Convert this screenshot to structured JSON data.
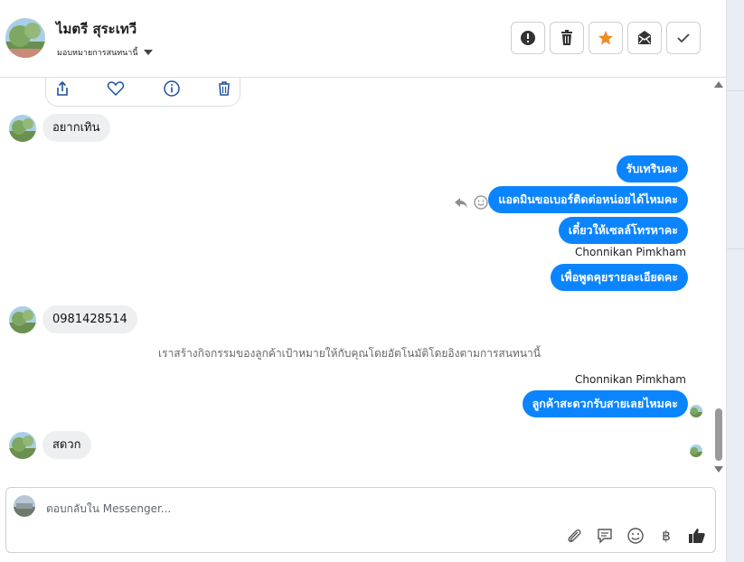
{
  "header": {
    "contact_name": "ไมตรี สุระเทวี",
    "assign_label": "มอบหมายการสนทนานี้",
    "actions": [
      {
        "name": "report-spam-button",
        "icon": "exclamation-circle-icon"
      },
      {
        "name": "delete-button",
        "icon": "trash-icon"
      },
      {
        "name": "star-button",
        "icon": "star-icon",
        "color": "#f08a24"
      },
      {
        "name": "mark-unread-button",
        "icon": "envelope-icon"
      },
      {
        "name": "mark-done-button",
        "icon": "check-icon"
      }
    ]
  },
  "attachment_actions": [
    "share-icon",
    "heart-icon",
    "info-icon",
    "trash-icon"
  ],
  "messages": {
    "in_1": "อยากเทิน",
    "out_1": "รับเทรินคะ",
    "out_2": "แอดมินขอเบอร์ติดต่อหน่อยได้ไหมคะ",
    "out_3": "เดี๋ยวให้เซลล์โทรหาคะ",
    "sender_1": "Chonnikan Pimkham",
    "out_4": "เพื่อพูดคุยรายละเอียดคะ",
    "in_2": "0981428514",
    "system_note": "เราสร้างกิจกรรมของลูกค้าเป้าหมายให้กับคุณโดยอัตโนมัติโดยอิงตามการสนทนานี้",
    "sender_2": "Chonnikan Pimkham",
    "out_5": "ลูกค้าสะดวกรับสายเลยไหมคะ",
    "in_3": "สดวก"
  },
  "composer": {
    "placeholder": "ตอบกลับใน Messenger...",
    "tools": [
      "paperclip-icon",
      "chat-bubble-icon",
      "smiley-icon",
      "baht-icon",
      "thumbs-up-icon"
    ],
    "baht_symbol": "฿"
  },
  "colors": {
    "outgoing_bubble": "#0b84ff",
    "incoming_bubble": "#eeeff1",
    "star": "#f08a24"
  }
}
